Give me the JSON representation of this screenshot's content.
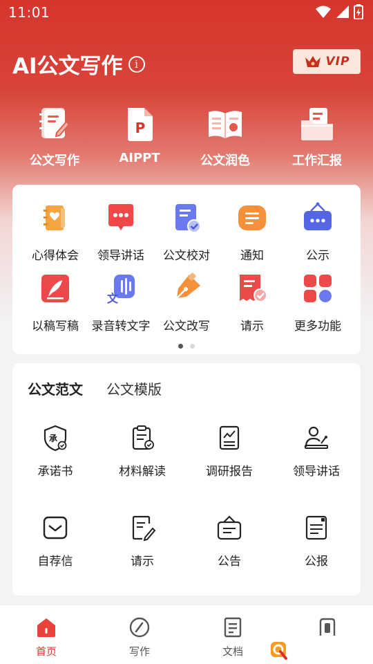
{
  "status_bar": {
    "time": "11:01"
  },
  "header": {
    "title": "AI公文写作",
    "info_icon": "info-icon",
    "vip_label": "VIP"
  },
  "top_features": [
    {
      "label": "公文写作",
      "icon": "document-pen-icon"
    },
    {
      "label": "AIPPT",
      "icon": "ppt-icon"
    },
    {
      "label": "公文润色",
      "icon": "open-book-icon"
    },
    {
      "label": "工作汇报",
      "icon": "folder-report-icon"
    }
  ],
  "tools": [
    {
      "label": "心得体会",
      "icon": "notebook-heart-icon"
    },
    {
      "label": "领导讲话",
      "icon": "speech-bubble-icon"
    },
    {
      "label": "公文校对",
      "icon": "doc-check-icon"
    },
    {
      "label": "通知",
      "icon": "notice-icon"
    },
    {
      "label": "公示",
      "icon": "billboard-icon"
    },
    {
      "label": "以稿写稿",
      "icon": "quill-icon"
    },
    {
      "label": "录音转文字",
      "icon": "voice-to-text-icon"
    },
    {
      "label": "公文改写",
      "icon": "pen-nib-icon"
    },
    {
      "label": "请示",
      "icon": "receipt-check-icon"
    },
    {
      "label": "更多功能",
      "icon": "apps-grid-icon"
    }
  ],
  "doc_tabs": [
    "公文范文",
    "公文模版"
  ],
  "doc_items": [
    {
      "label": "承诺书",
      "icon": "shield-promise-icon",
      "badge": "承"
    },
    {
      "label": "材料解读",
      "icon": "clipboard-check-icon"
    },
    {
      "label": "调研报告",
      "icon": "chart-report-icon"
    },
    {
      "label": "领导讲话",
      "icon": "podium-speaker-icon"
    },
    {
      "label": "自荐信",
      "icon": "envelope-icon"
    },
    {
      "label": "请示",
      "icon": "doc-edit-icon"
    },
    {
      "label": "公告",
      "icon": "announcement-icon"
    },
    {
      "label": "公报",
      "icon": "bulletin-icon"
    }
  ],
  "bottom_nav": [
    {
      "label": "首页",
      "icon": "home-icon",
      "active": true
    },
    {
      "label": "写作",
      "icon": "compass-icon"
    },
    {
      "label": "文档",
      "icon": "document-icon"
    },
    {
      "label": "",
      "icon": "profile-icon"
    }
  ],
  "colors": {
    "brand_red": "#d5352c",
    "vip_bg": "#fbe7dc",
    "nav_active": "#d8352b"
  }
}
